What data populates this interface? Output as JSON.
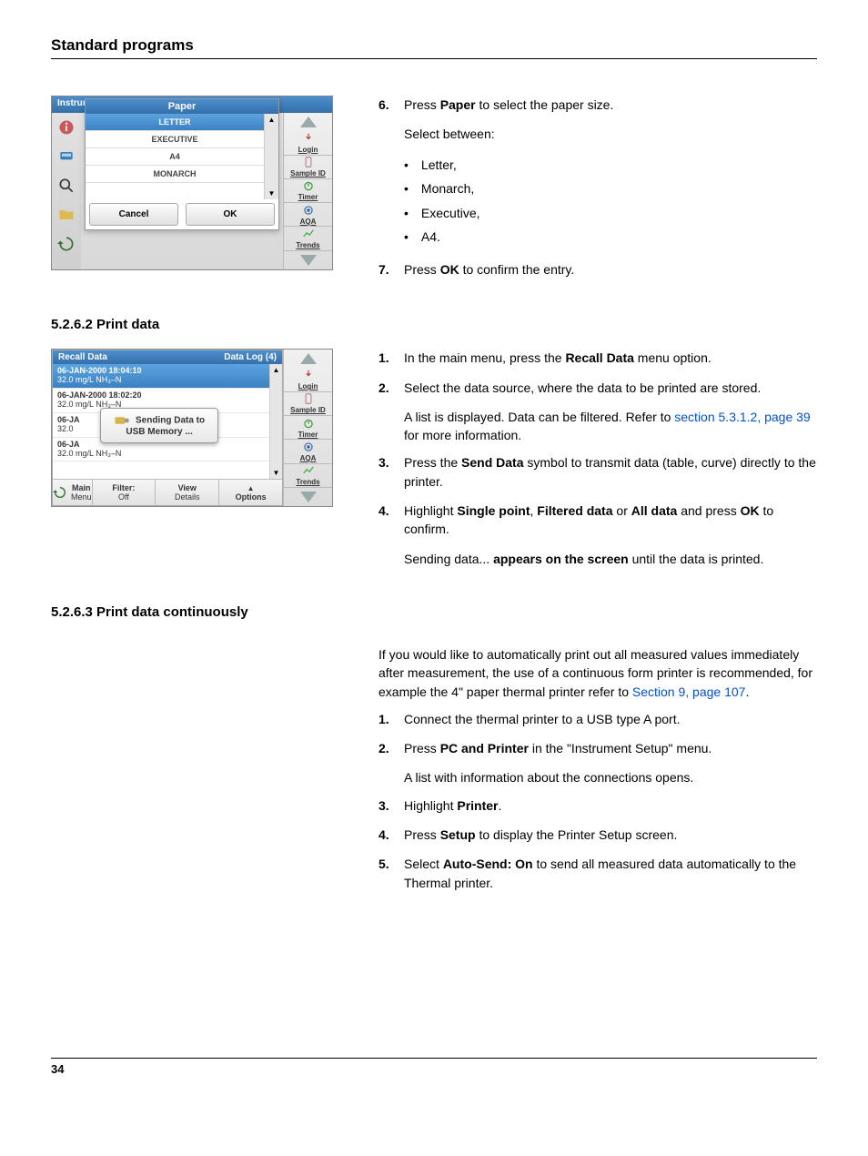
{
  "page": {
    "title": "Standard programs",
    "number": "34"
  },
  "block1": {
    "steps": [
      {
        "num": "6.",
        "html": "Press <b>Paper</b> to select the paper size."
      },
      {
        "num": "7.",
        "html": "Press <b>OK</b> to confirm the entry."
      }
    ],
    "select_between": "Select between:",
    "options": [
      "Letter,",
      "Monarch,",
      "Executive,",
      "A4."
    ]
  },
  "sec2": {
    "heading": "5.2.6.2  Print data",
    "steps": [
      {
        "num": "1.",
        "html": "In the main menu, press the <b>Recall Data</b> menu option."
      },
      {
        "num": "2.",
        "html": "Select the data source, where the data to be printed are stored."
      },
      {
        "num": "3.",
        "html": "Press the <b>Send Data</b> symbol to transmit data (table, curve) directly to the printer."
      },
      {
        "num": "4.",
        "html": "Highlight <b>Single point</b>, <b>Filtered data</b> or <b>All data</b> and press <b>OK</b> to confirm."
      }
    ],
    "list_note": "A list is displayed. Data can be filtered. Refer to ",
    "list_link": "section 5.3.1.2, page 39",
    "list_after": " for more information.",
    "sending_note_pre": "Sending data... ",
    "sending_note_bold": "appears on the screen",
    "sending_note_post": " until the data is printed."
  },
  "sec3": {
    "heading": "5.2.6.3  Print data continuously",
    "intro_pre": "If you would like to automatically print out all measured values immediately after measurement, the use of a continuous form printer is recommended, for example the 4\" paper thermal printer refer to ",
    "intro_link": "Section 9, page 107",
    "intro_post": ".",
    "steps": [
      {
        "num": "1.",
        "html": "Connect the thermal printer to a USB type A port."
      },
      {
        "num": "2.",
        "html": "Press <b>PC and Printer </b> in the \"Instrument Setup\" menu."
      },
      {
        "num": "3.",
        "html": "Highlight <b>Printer</b>."
      },
      {
        "num": "4.",
        "html": "Press <b>Setup</b> to display the Printer Setup screen."
      },
      {
        "num": "5.",
        "html": "Select <b>Auto-Send: On</b> to send all measured data automatically to the Thermal printer."
      }
    ],
    "list_note": "A list with information about the connections opens."
  },
  "s1": {
    "header": "Instrument Setup",
    "dlg_title": "Paper",
    "items": [
      "LETTER",
      "EXECUTIVE",
      "A4",
      "MONARCH"
    ],
    "selected": 0,
    "cancel": "Cancel",
    "ok": "OK",
    "side": [
      "Login",
      "Sample ID",
      "Timer",
      "AQA",
      "Trends"
    ]
  },
  "s2": {
    "title": "Recall Data",
    "count": "Data Log (4)",
    "rows": [
      {
        "l1": "06-JAN-2000  18:04:10",
        "l2": "32.0  mg/L  NH₃–N",
        "sel": true
      },
      {
        "l1": "06-JAN-2000  18:02:20",
        "l2": "32.0  mg/L  NH₃–N",
        "sel": false
      },
      {
        "l1": "06-JA",
        "l2": "32.0",
        "sel": false
      },
      {
        "l1": "06-JA",
        "l2": "32.0  mg/L  NH₃–N",
        "sel": false
      }
    ],
    "popup1": "Sending Data to",
    "popup2": "USB Memory ...",
    "side": [
      "Login",
      "Sample ID",
      "Timer",
      "AQA",
      "Trends"
    ],
    "bottom": {
      "back_top": "Main",
      "back_bot": "Menu",
      "filter_top": "Filter:",
      "filter_bot": "Off",
      "view_top": "View",
      "view_bot": "Details",
      "options": "Options"
    }
  }
}
